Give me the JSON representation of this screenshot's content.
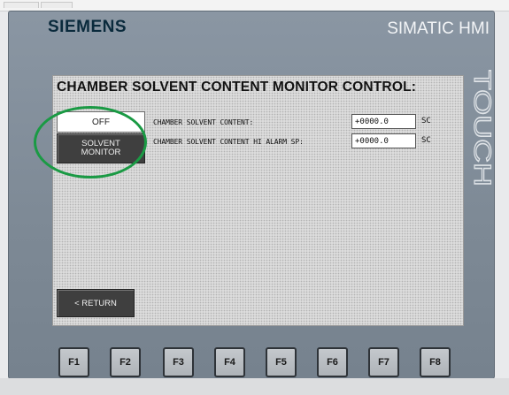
{
  "panel": {
    "brand": "SIEMENS",
    "model": "SIMATIC HMI",
    "touch_label": "TOUCH"
  },
  "screen": {
    "title": "CHAMBER SOLVENT CONTENT MONITOR CONTROL:",
    "off_button": "OFF",
    "monitor_button": [
      "SOLVENT",
      "MONITOR"
    ],
    "rows": [
      {
        "label": "CHAMBER SOLVENT CONTENT:",
        "value": "+0000.0",
        "unit": "SC"
      },
      {
        "label": "CHAMBER SOLVENT CONTENT HI ALARM SP:",
        "value": "+0000.0",
        "unit": "SC"
      }
    ],
    "return_button": "< RETURN"
  },
  "function_keys": [
    "F1",
    "F2",
    "F3",
    "F4",
    "F5",
    "F6",
    "F7",
    "F8"
  ],
  "annotation": {
    "highlight_color": "#1a9a44"
  }
}
